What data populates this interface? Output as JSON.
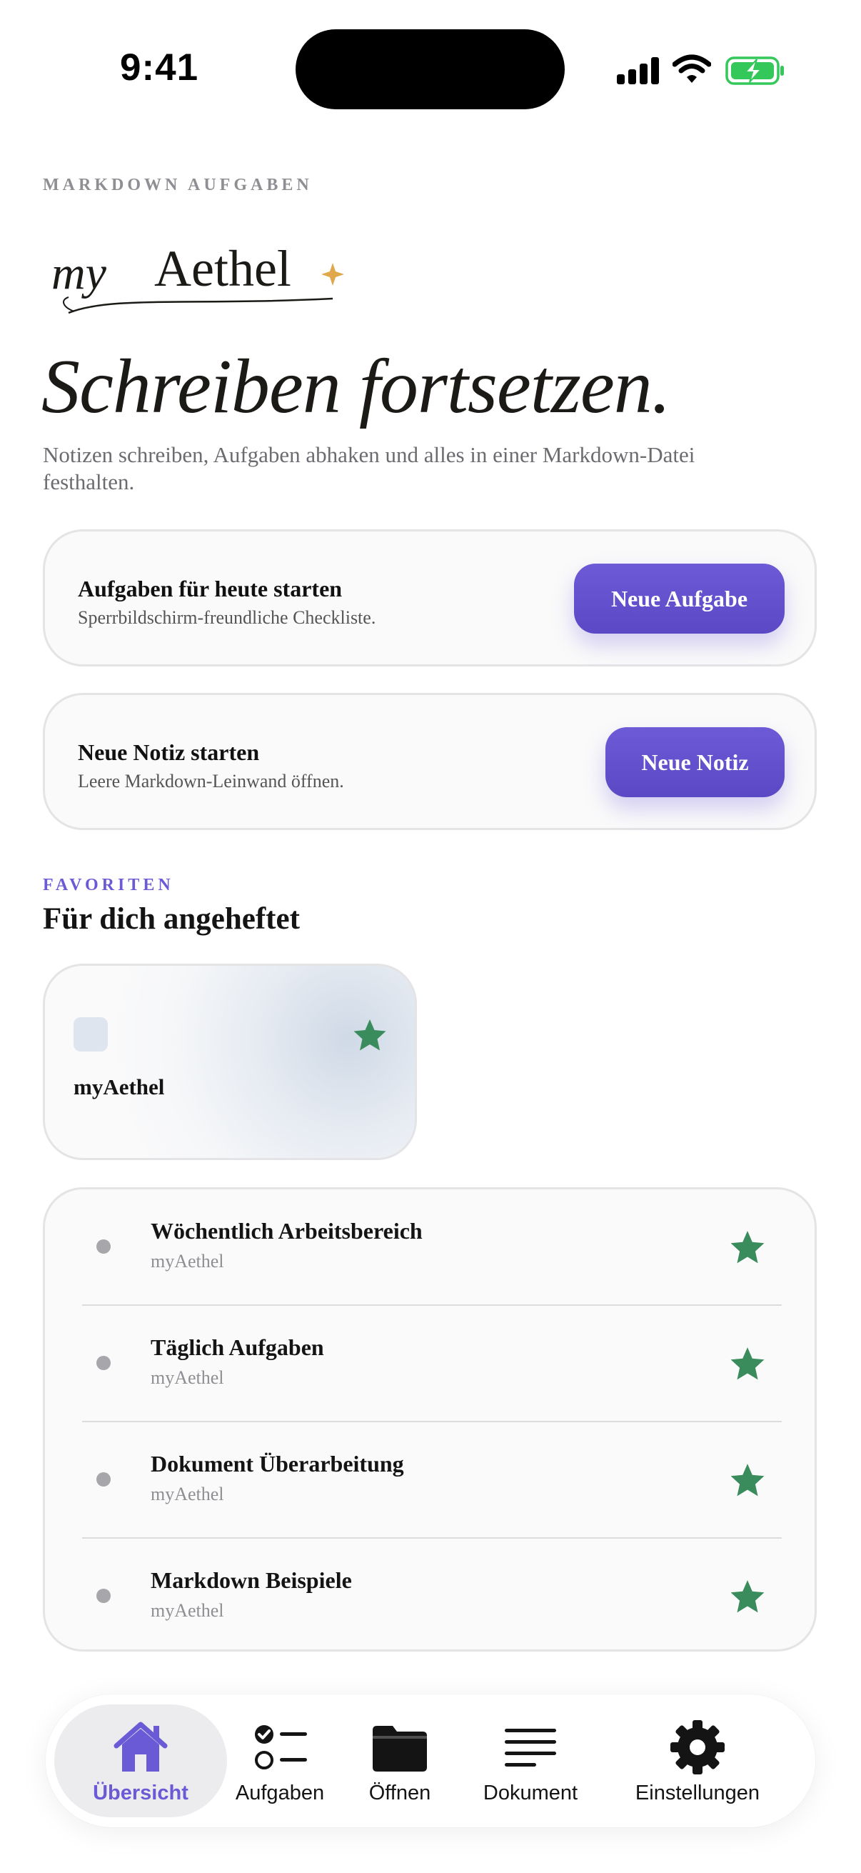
{
  "status_bar": {
    "time": "9:41"
  },
  "header": {
    "eyebrow": "MARKDOWN AUFGABEN",
    "logo_text": "myAethel",
    "headline": "Schreiben fortsetzen.",
    "subtitle": "Notizen schreiben, Aufgaben abhaken und alles in einer Markdown-Datei festhalten."
  },
  "actions": [
    {
      "title": "Aufgaben für heute starten",
      "subtitle": "Sperrbildschirm-freundliche Checkliste.",
      "button": "Neue Aufgabe"
    },
    {
      "title": "Neue Notiz starten",
      "subtitle": "Leere Markdown-Leinwand öffnen.",
      "button": "Neue Notiz"
    }
  ],
  "favorites": {
    "eyebrow": "FAVORITEN",
    "heading": "Für dich angeheftet",
    "pinned_card": {
      "title": "myAethel",
      "icon": "star-icon"
    },
    "items": [
      {
        "title": "Wöchentlich Arbeitsbereich",
        "subtitle": "myAethel",
        "starred": true
      },
      {
        "title": "Täglich Aufgaben",
        "subtitle": "myAethel",
        "starred": true
      },
      {
        "title": "Dokument Überarbeitung",
        "subtitle": "myAethel",
        "starred": true
      },
      {
        "title": "Markdown Beispiele",
        "subtitle": "myAethel",
        "starred": true
      }
    ]
  },
  "tabbar": {
    "tabs": [
      {
        "label": "Übersicht",
        "icon": "home-icon",
        "active": true
      },
      {
        "label": "Aufgaben",
        "icon": "checklist-icon",
        "active": false
      },
      {
        "label": "Öffnen",
        "icon": "folder-icon",
        "active": false
      },
      {
        "label": "Dokument",
        "icon": "document-lines-icon",
        "active": false
      },
      {
        "label": "Einstellungen",
        "icon": "gear-icon",
        "active": false
      }
    ]
  },
  "colors": {
    "accent": "#6a5ad6",
    "star": "#3a8c5c",
    "battery": "#34c759"
  }
}
